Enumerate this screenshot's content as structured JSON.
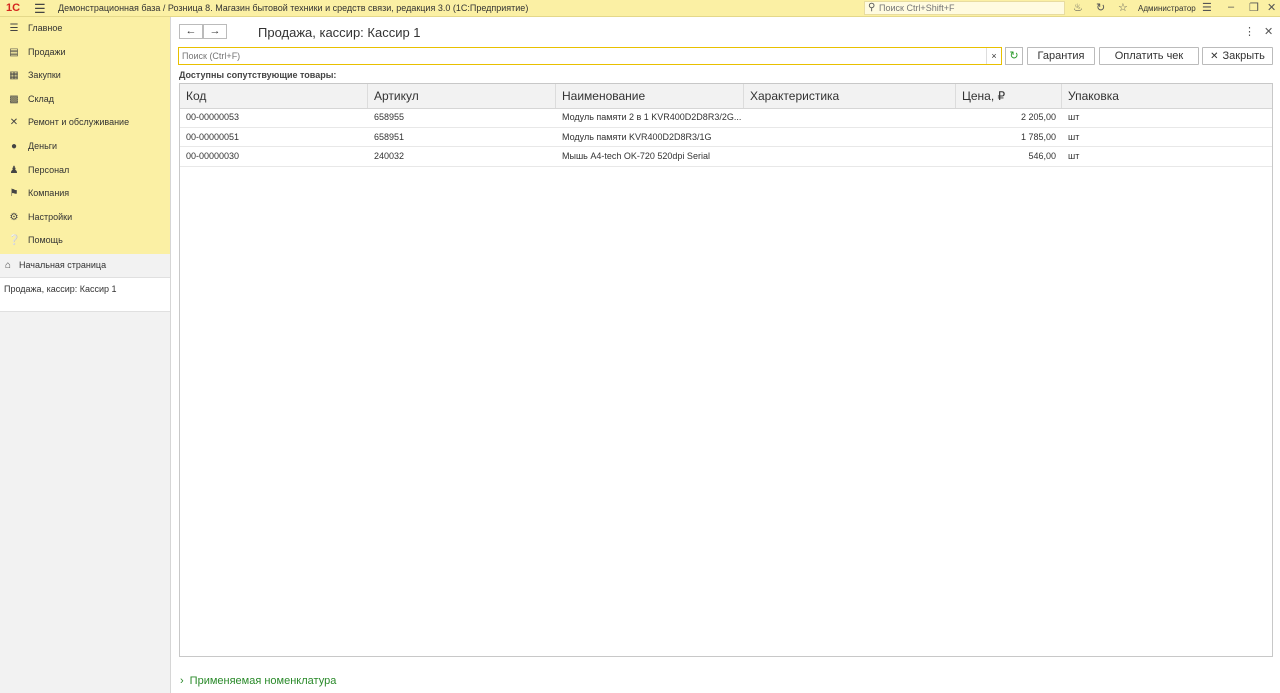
{
  "app": {
    "logo": "1С",
    "title": "Демонстрационная база / Розница 8. Магазин бытовой техники и средств связи, редакция 3.0  (1С:Предприятие)",
    "search_placeholder": "Поиск Ctrl+Shift+F",
    "user": "Администратор"
  },
  "sidebar": {
    "sections": [
      {
        "label": "Главное",
        "icon": "menu-lines-icon"
      },
      {
        "label": "Продажи",
        "icon": "cart-icon"
      },
      {
        "label": "Закупки",
        "icon": "purchase-icon"
      },
      {
        "label": "Склад",
        "icon": "warehouse-icon"
      },
      {
        "label": "Ремонт и обслуживание",
        "icon": "wrench-icon"
      },
      {
        "label": "Деньги",
        "icon": "money-icon"
      },
      {
        "label": "Персонал",
        "icon": "people-icon"
      },
      {
        "label": "Компания",
        "icon": "flag-icon"
      },
      {
        "label": "Настройки",
        "icon": "gear-icon"
      },
      {
        "label": "Помощь",
        "icon": "help-icon"
      }
    ],
    "home": "Начальная страница",
    "open_windows": [
      "Продажа, кассир: Кассир 1"
    ]
  },
  "form": {
    "title": "Продажа, кассир: Кассир 1",
    "search_placeholder": "Поиск (Ctrl+F)",
    "buttons": {
      "warranty": "Гарантия",
      "pay": "Оплатить чек",
      "close": "Закрыть"
    },
    "list_label": "Доступны сопутствующие товары:",
    "columns": [
      "Код",
      "Артикул",
      "Наименование",
      "Характеристика",
      "Цена, ₽",
      "Упаковка"
    ],
    "rows": [
      {
        "code": "00-00000053",
        "article": "658955",
        "name": "Модуль памяти 2 в 1 KVR400D2D8R3/2G...",
        "characteristic": "",
        "price": "2 205,00",
        "pack": "шт"
      },
      {
        "code": "00-00000051",
        "article": "658951",
        "name": "Модуль памяти KVR400D2D8R3/1G",
        "characteristic": "",
        "price": "1 785,00",
        "pack": "шт"
      },
      {
        "code": "00-00000030",
        "article": "240032",
        "name": "Мышь A4-tech OK-720 520dpi Serial",
        "characteristic": "",
        "price": "546,00",
        "pack": "шт"
      }
    ],
    "footer_link": "Применяемая номенклатура"
  },
  "colors": {
    "accent": "#fbf0a4",
    "link_green": "#2a8a2a",
    "logo_red": "#d4271f"
  }
}
